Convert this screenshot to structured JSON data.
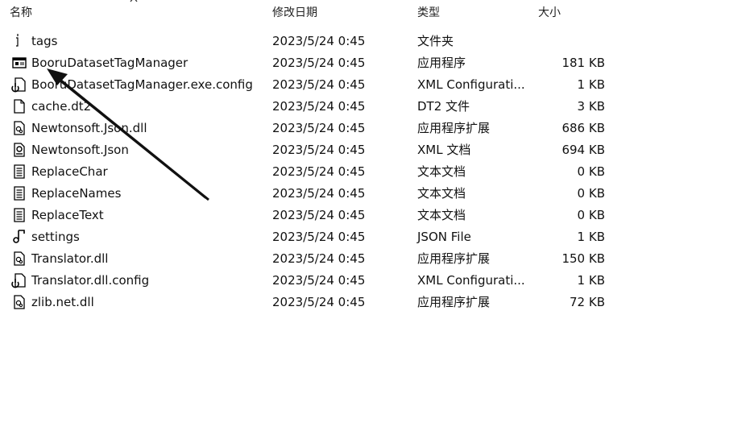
{
  "header": {
    "name": "名称",
    "date": "修改日期",
    "type": "类型",
    "size": "大小"
  },
  "files": [
    {
      "name": "tags",
      "date": "2023/5/24 0:45",
      "type": "文件夹",
      "size": "",
      "icon": "folder-icon"
    },
    {
      "name": "BooruDatasetTagManager",
      "date": "2023/5/24 0:45",
      "type": "应用程序",
      "size": "181 KB",
      "icon": "application-icon"
    },
    {
      "name": "BooruDatasetTagManager.exe.config",
      "date": "2023/5/24 0:45",
      "type": "XML Configurati...",
      "size": "1 KB",
      "icon": "config-file-icon"
    },
    {
      "name": "cache.dt2",
      "date": "2023/5/24 0:45",
      "type": "DT2 文件",
      "size": "3 KB",
      "icon": "blank-file-icon"
    },
    {
      "name": "Newtonsoft.Json.dll",
      "date": "2023/5/24 0:45",
      "type": "应用程序扩展",
      "size": "686 KB",
      "icon": "dll-file-icon"
    },
    {
      "name": "Newtonsoft.Json",
      "date": "2023/5/24 0:45",
      "type": "XML 文档",
      "size": "694 KB",
      "icon": "xml-file-icon"
    },
    {
      "name": "ReplaceChar",
      "date": "2023/5/24 0:45",
      "type": "文本文档",
      "size": "0 KB",
      "icon": "text-file-icon"
    },
    {
      "name": "ReplaceNames",
      "date": "2023/5/24 0:45",
      "type": "文本文档",
      "size": "0 KB",
      "icon": "text-file-icon"
    },
    {
      "name": "ReplaceText",
      "date": "2023/5/24 0:45",
      "type": "文本文档",
      "size": "0 KB",
      "icon": "text-file-icon"
    },
    {
      "name": "settings",
      "date": "2023/5/24 0:45",
      "type": "JSON File",
      "size": "1 KB",
      "icon": "json-file-icon"
    },
    {
      "name": "Translator.dll",
      "date": "2023/5/24 0:45",
      "type": "应用程序扩展",
      "size": "150 KB",
      "icon": "dll-file-icon"
    },
    {
      "name": "Translator.dll.config",
      "date": "2023/5/24 0:45",
      "type": "XML Configurati...",
      "size": "1 KB",
      "icon": "config-file-icon"
    },
    {
      "name": "zlib.net.dll",
      "date": "2023/5/24 0:45",
      "type": "应用程序扩展",
      "size": "72 KB",
      "icon": "dll-file-icon"
    }
  ]
}
